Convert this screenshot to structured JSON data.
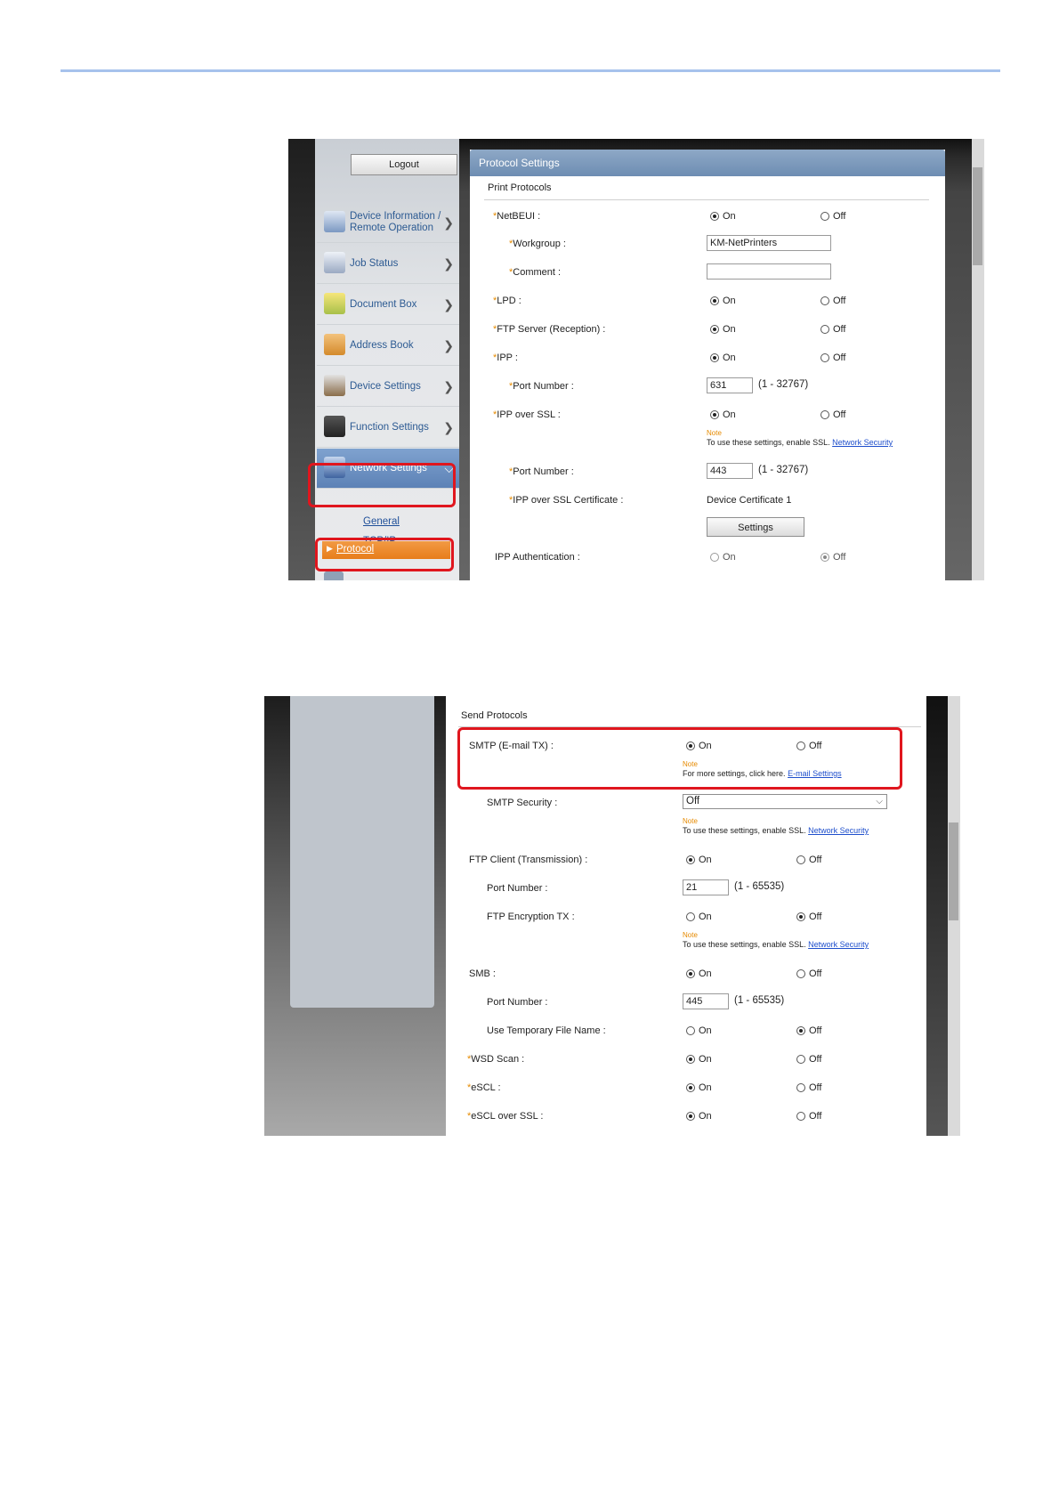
{
  "sidebar": {
    "logout": "Logout",
    "items": [
      {
        "label": "Device Information / Remote Operation",
        "icon": "device-info-icon"
      },
      {
        "label": "Job Status",
        "icon": "job-status-icon"
      },
      {
        "label": "Document Box",
        "icon": "document-box-icon"
      },
      {
        "label": "Address Book",
        "icon": "address-book-icon"
      },
      {
        "label": "Device Settings",
        "icon": "device-settings-icon"
      },
      {
        "label": "Function Settings",
        "icon": "function-settings-icon"
      },
      {
        "label": "Network Settings",
        "icon": "network-settings-icon"
      }
    ],
    "subitems": [
      "General",
      "TCP/IP",
      "Protocol"
    ]
  },
  "protocol": {
    "title": "Protocol Settings",
    "print_section": "Print Protocols",
    "on": "On",
    "off": "Off",
    "netbeui": "NetBEUI :",
    "workgroup": "Workgroup :",
    "workgroup_value": "KM-NetPrinters",
    "comment": "Comment :",
    "comment_value": "",
    "lpd": "LPD :",
    "ftp_server": "FTP Server (Reception) :",
    "ipp": "IPP :",
    "port_number": "Port Number :",
    "ipp_port": "631",
    "ipp_range": "(1 - 32767)",
    "ipp_ssl": "IPP over SSL :",
    "note": "Note",
    "ssl_note": "To use these settings, enable SSL.",
    "network_security": "Network Security",
    "ssl_port": "443",
    "ssl_range": "(1 - 32767)",
    "ssl_cert": "IPP over SSL Certificate :",
    "cert_value": "Device Certificate 1",
    "settings_btn": "Settings",
    "ipp_auth": "IPP Authentication :"
  },
  "send": {
    "section": "Send Protocols",
    "smtp": "SMTP (E-mail TX) :",
    "smtp_note": "For more settings, click here.",
    "email_settings": "E-mail Settings",
    "smtp_security": "SMTP Security :",
    "smtp_security_value": "Off",
    "ftp_client": "FTP Client (Transmission) :",
    "ftp_port": "21",
    "ftp_range": "(1 - 65535)",
    "ftp_encryption": "FTP Encryption TX :",
    "smb": "SMB :",
    "smb_port": "445",
    "smb_range": "(1 - 65535)",
    "temp_file": "Use Temporary File Name :",
    "wsd_scan": "WSD Scan :",
    "escl": "eSCL :",
    "escl_ssl": "eSCL over SSL :"
  }
}
